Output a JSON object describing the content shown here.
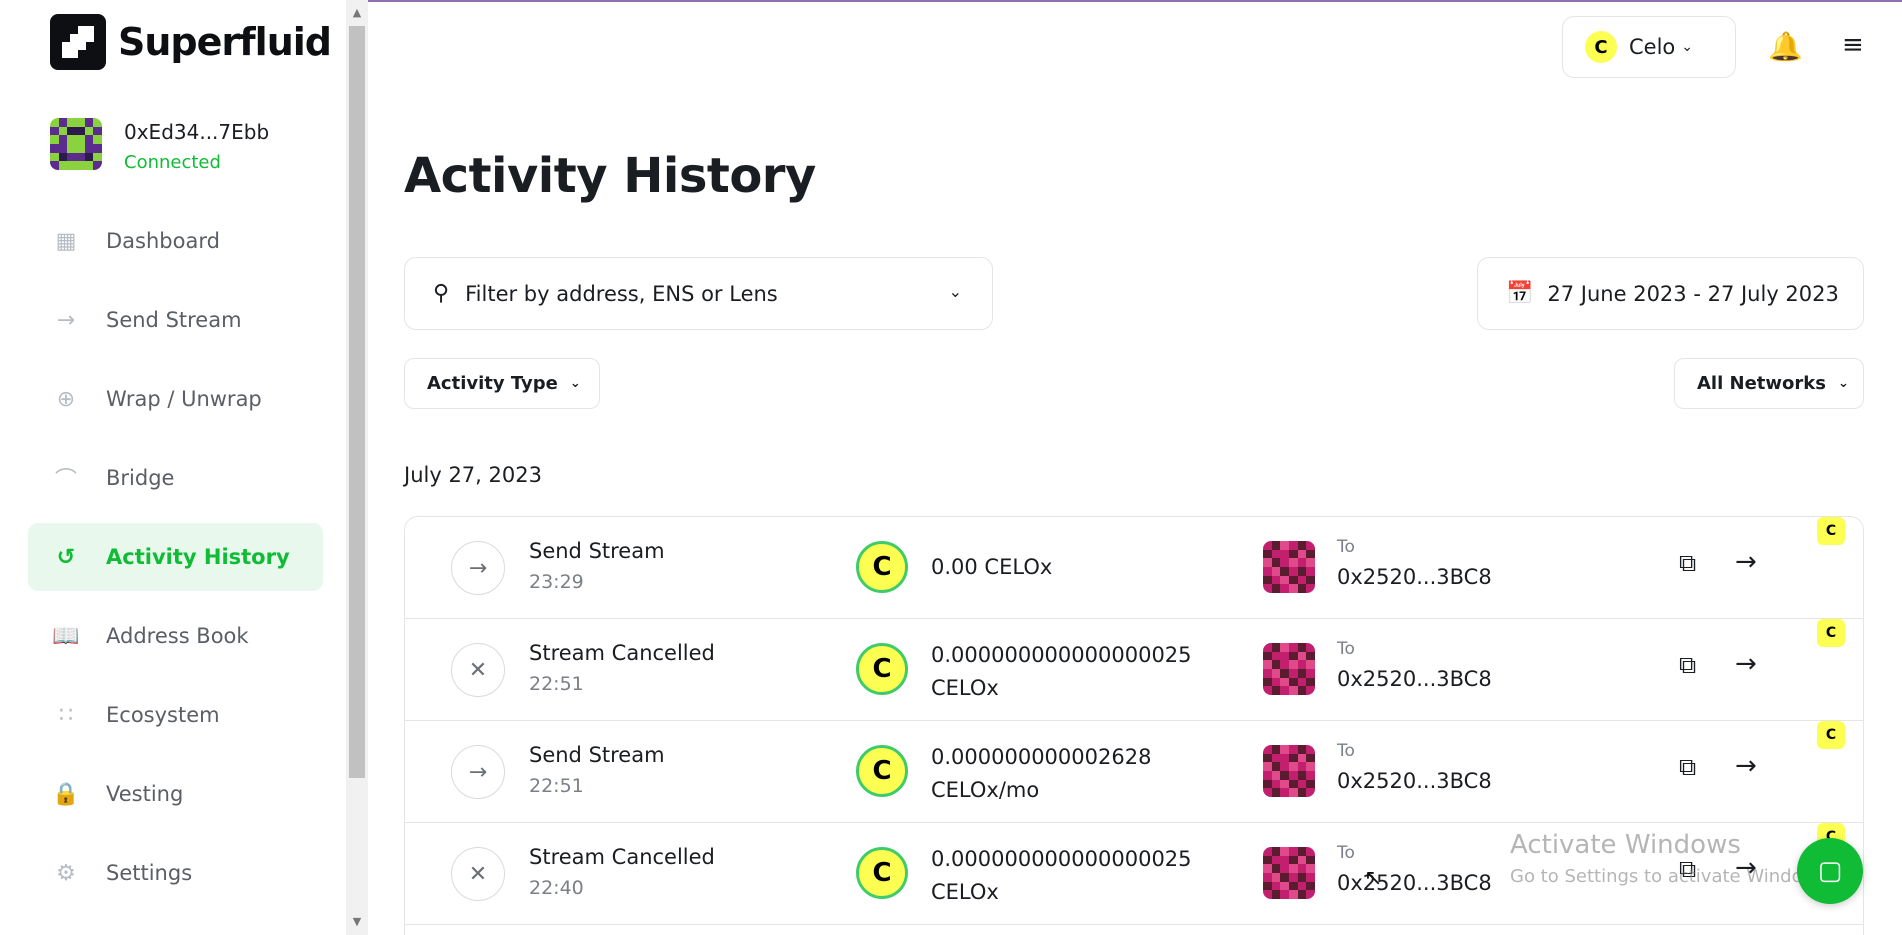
{
  "app": {
    "brand": "Superfluid"
  },
  "account": {
    "address": "0xEd34...7Ebb",
    "status": "Connected"
  },
  "sidebar": {
    "items": [
      {
        "label": "Dashboard",
        "icon": "dashboard-icon"
      },
      {
        "label": "Send Stream",
        "icon": "arrow-right-icon"
      },
      {
        "label": "Wrap / Unwrap",
        "icon": "wrap-icon"
      },
      {
        "label": "Bridge",
        "icon": "bridge-icon"
      },
      {
        "label": "Activity History",
        "icon": "history-icon",
        "active": true
      },
      {
        "label": "Address Book",
        "icon": "book-icon"
      },
      {
        "label": "Ecosystem",
        "icon": "grid-icon"
      },
      {
        "label": "Vesting",
        "icon": "lock-icon"
      },
      {
        "label": "Settings",
        "icon": "gear-icon"
      }
    ]
  },
  "header": {
    "network": "Celo",
    "network_coin": "C"
  },
  "main": {
    "title": "Activity History",
    "filter_placeholder": "Filter by address, ENS or Lens",
    "date_range": "27 June 2023 - 27 July 2023",
    "activity_type": "Activity Type",
    "networks": "All Networks",
    "date_group": "July 27, 2023"
  },
  "activities": [
    {
      "title": "Send Stream",
      "time": "23:29",
      "amount_line1": "0.00 CELOx",
      "amount_line2": "",
      "to_label": "To",
      "to": "0x2520...3BC8",
      "type": "send"
    },
    {
      "title": "Stream Cancelled",
      "time": "22:51",
      "amount_line1": "0.000000000000000025",
      "amount_line2": "CELOx",
      "to_label": "To",
      "to": "0x2520...3BC8",
      "type": "cancel"
    },
    {
      "title": "Send Stream",
      "time": "22:51",
      "amount_line1": "0.000000000002628",
      "amount_line2": "CELOx/mo",
      "to_label": "To",
      "to": "0x2520...3BC8",
      "type": "send"
    },
    {
      "title": "Stream Cancelled",
      "time": "22:40",
      "amount_line1": "0.000000000000000025",
      "amount_line2": "CELOx",
      "to_label": "To",
      "to": "0x2520...3BC8",
      "type": "cancel"
    }
  ],
  "watermark": {
    "line1": "Activate Windows",
    "line2": "Go to Settings to activate Windows."
  },
  "colors": {
    "accent": "#10bb35",
    "celo": "#fcff52"
  }
}
